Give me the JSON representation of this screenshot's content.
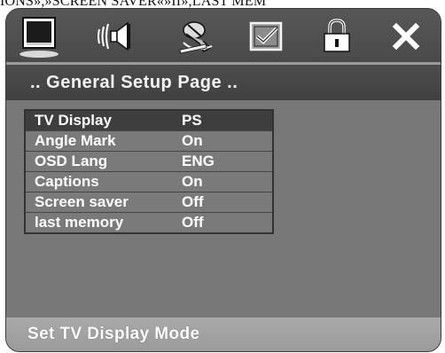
{
  "caption": "IONS»,»SCREEN SAVER«»II»,LAST MEM",
  "icons": [
    "tv-display-icon",
    "audio-icon",
    "video-icon",
    "preference-icon",
    "password-lock-icon",
    "exit-icon"
  ],
  "header": {
    "title": ".. General Setup Page .."
  },
  "menu": {
    "items": [
      {
        "label": "TV Display",
        "value": "PS"
      },
      {
        "label": "Angle Mark",
        "value": "On"
      },
      {
        "label": "OSD Lang",
        "value": "ENG"
      },
      {
        "label": "Captions",
        "value": "On"
      },
      {
        "label": "Screen saver",
        "value": "Off"
      },
      {
        "label": "last memory",
        "value": "Off"
      }
    ],
    "selected_index": 0
  },
  "status": {
    "text": "Set TV Display Mode"
  },
  "colors": {
    "panel": "#737373",
    "header": "#444444",
    "selected_row": "#3e3e3e",
    "status_bar": "#a3a3a3"
  }
}
